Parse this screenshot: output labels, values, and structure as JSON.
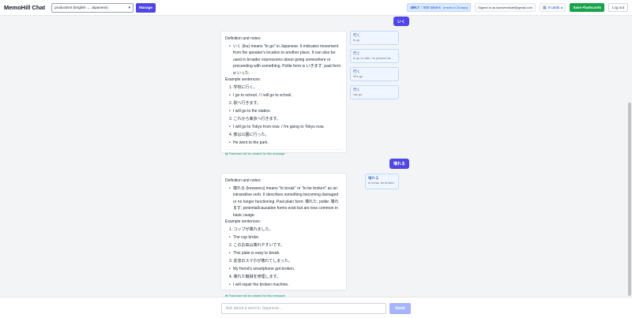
{
  "header": {
    "title": "MemoHill Chat",
    "deck_select": "productivnt (English → Japanese)",
    "manage_label": "Manage",
    "tokens_used": "499.7",
    "tokens_sep": "/",
    "tokens_limit": "500 tokens",
    "tokens_reset": "(resets in 26 days)",
    "signed_in": "Signed in as lacewenchaft@gmail.com",
    "cards_label": "0 cards",
    "save_label": "Save Flashcards",
    "logout_label": "Log out"
  },
  "messages": [
    {
      "user_word": "いく",
      "definition_heading": "Definition and notes:",
      "definition": "いく (iku) means \"to go\" in Japanese. It indicates movement from the speaker's location to another place. It can also be used in broader expressions about going somewhere or proceeding with something. Polite form is いきます; past form is いった.",
      "examples_heading": "Example sentences:",
      "examples": [
        {
          "jp": "1. 学校に行く。",
          "en": "I go to school. / I will go to school."
        },
        {
          "jp": "2. 駅へ行きます。",
          "en": "I will go to the station."
        },
        {
          "jp": "3. これから東京へ行きます。",
          "en": "I will go to Tokyo from now. / I'm going to Tokyo now."
        },
        {
          "jp": "4. 彼は公園に行った。",
          "en": "He went to the park."
        }
      ],
      "footer": "Flashcard will be created for this message",
      "suggestions": [
        {
          "word": "行く",
          "meaning": "to go"
        },
        {
          "word": "行く",
          "meaning": "to go on with / to proceed wi..."
        },
        {
          "word": "行く",
          "meaning": "let's go"
        },
        {
          "word": "行く",
          "meaning": "can go"
        }
      ]
    },
    {
      "user_word": "壊れる",
      "definition_heading": "Definition and notes:",
      "definition": "壊れる (kowareru) means \"to break\" or \"to be broken\" as an intransitive verb. It describes something becoming damaged or no longer functioning. Past plain form: 壊れた; polite: 壊れます; potential/causative forms exist but are less common in basic usage.",
      "examples_heading": "Example sentences:",
      "examples": [
        {
          "jp": "1. コップが壊れました。",
          "en": "The cup broke."
        },
        {
          "jp": "2. このお皿は壊れやすいです。",
          "en": "This plate is easy to break."
        },
        {
          "jp": "3. 友達のスマホが壊れてしまった。",
          "en": "My friend's smartphone got broken."
        },
        {
          "jp": "4. 壊れた機械を修理します。",
          "en": "I will repair the broken machine."
        }
      ],
      "footer": "Flashcard will be created for this message",
      "suggestions": [
        {
          "word": "壊れる",
          "meaning": "to break, be broken"
        }
      ]
    }
  ],
  "composer": {
    "placeholder": "Ask about a word in Japanese...",
    "send_label": "Send"
  },
  "icons": {
    "cards": "cards-icon",
    "footer": "card-icon",
    "dropdown": "chevron-down-icon"
  },
  "colors": {
    "accent": "#4f46e5",
    "save": "#16a34a",
    "send_disabled": "#a5b4fc",
    "suggestion_bg": "#eff6ff",
    "footer_text": "#059669"
  }
}
